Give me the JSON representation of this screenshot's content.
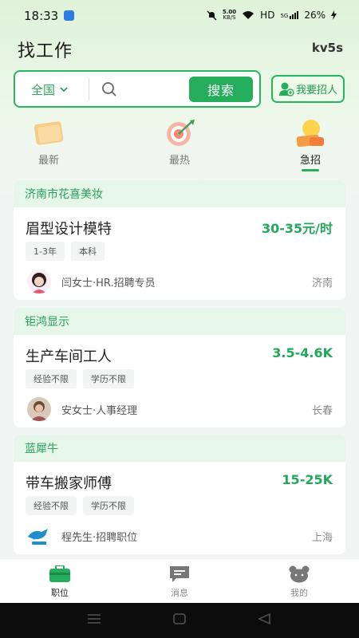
{
  "status_bar": {
    "time": "18:33",
    "speed_value": "5.00",
    "speed_unit": "KB/S",
    "network": "HD",
    "signal": "5G",
    "battery": "26%"
  },
  "header": {
    "title": "找工作",
    "user_code": "kv5s"
  },
  "search": {
    "region": "全国",
    "placeholder": "",
    "button_label": "搜索"
  },
  "recruit_button": {
    "label": "我要招人"
  },
  "categories": [
    {
      "label": "最新",
      "icon": "scroll-icon"
    },
    {
      "label": "最热",
      "icon": "target-icon"
    },
    {
      "label": "急招",
      "icon": "bulb-alarm-icon",
      "active": true
    }
  ],
  "jobs": [
    {
      "company": "济南市花喜美妆",
      "title": "眉型设计模特",
      "salary": "30-35元/时",
      "tags": [
        "1-3年",
        "本科"
      ],
      "recruiter": "闫女士·HR.招聘专员",
      "city": "济南"
    },
    {
      "company": "钜鸿显示",
      "title": "生产车间工人",
      "salary": "3.5-4.6K",
      "tags": [
        "经验不限",
        "学历不限"
      ],
      "recruiter": "安女士·人事经理",
      "city": "长春"
    },
    {
      "company": "蓝犀牛",
      "title": "带车搬家师傅",
      "salary": "15-25K",
      "tags": [
        "经验不限",
        "学历不限"
      ],
      "recruiter": "程先生·招聘职位",
      "city": "上海"
    }
  ],
  "nav": [
    {
      "label": "职位",
      "icon": "briefcase-icon",
      "active": true
    },
    {
      "label": "消息",
      "icon": "message-icon"
    },
    {
      "label": "我的",
      "icon": "bear-icon"
    }
  ],
  "colors": {
    "accent": "#25ad5b",
    "card_header_bg": "#e6f6e8"
  }
}
